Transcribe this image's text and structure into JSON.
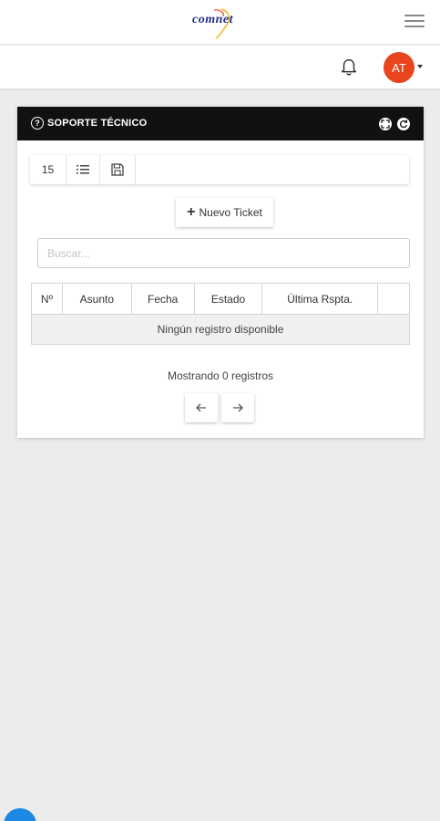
{
  "header": {
    "logo_text": "comnet",
    "menu_icon": "hamburger-icon",
    "brand_color": "#1f2f8f"
  },
  "user": {
    "initials": "AT",
    "avatar_color": "#e8441e",
    "notification_icon": "bell-icon"
  },
  "card": {
    "title": "SOPORTE TÉCNICO",
    "header_bg": "#111111"
  },
  "toolbar": {
    "page_size": "15"
  },
  "actions": {
    "new_ticket_label": "Nuevo Ticket"
  },
  "search": {
    "placeholder": "Buscar..."
  },
  "table": {
    "columns": [
      "Nº",
      "Asunto",
      "Fecha",
      "Estado",
      "Última Rspta.",
      ""
    ],
    "empty_message": "Ningún registro disponible"
  },
  "footer": {
    "record_count_text": "Mostrando 0 registros"
  },
  "fab_color": "#1e88e5"
}
